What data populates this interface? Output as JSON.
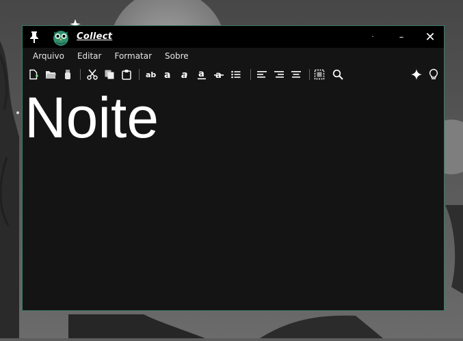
{
  "window": {
    "title": "Collect",
    "pin_icon": "pin-icon",
    "logo_icon": "owl-logo-icon",
    "controls": {
      "dot": "·",
      "minimize": "–",
      "close": "✕"
    },
    "border_color": "#3b7a6b"
  },
  "menu": {
    "items": [
      {
        "label": "Arquivo"
      },
      {
        "label": "Editar"
      },
      {
        "label": "Formatar"
      },
      {
        "label": "Sobre"
      }
    ]
  },
  "toolbar": {
    "groups": [
      [
        "new-file-icon",
        "open-folder-icon",
        "usb-drive-icon"
      ],
      [
        "cut-icon",
        "copy-icon",
        "paste-icon"
      ],
      [
        "font-size-icon",
        "bold-icon",
        "italic-icon",
        "underline-icon",
        "strikethrough-icon",
        "bullet-list-icon"
      ],
      [
        "align-left-icon",
        "align-right-icon",
        "align-center-icon"
      ],
      [
        "select-all-icon",
        "search-icon"
      ]
    ],
    "right": [
      "sparkle-icon",
      "lightbulb-icon"
    ]
  },
  "document": {
    "text": "Noite"
  },
  "colors": {
    "titlebar": "#000000",
    "editor_bg": "#141414",
    "text": "#ffffff",
    "accent_green": "#2f8f6f"
  }
}
